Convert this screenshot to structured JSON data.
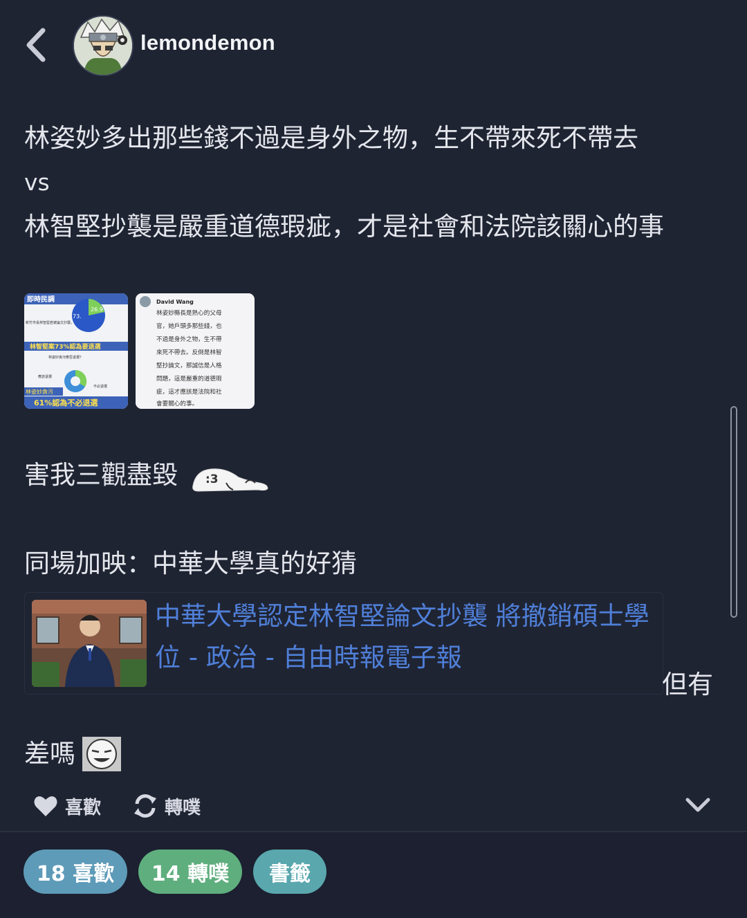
{
  "header": {
    "username": "lemondemon"
  },
  "post": {
    "line1": "林姿妙多出那些錢不過是身外之物，生不帶來死不帶去",
    "line2": "vs",
    "line3": "林智堅抄襲是嚴重道德瑕疵，才是社會和法院該關心的事",
    "section2": "害我三觀盡毀",
    "section3": "同場加映：中華大學真的好猜",
    "link_title": "中華大學認定林智堅論文抄襲 將撤銷碩士學位 - 政治 - 自由時報電子報",
    "after_link": "但有",
    "section4": "差嗎"
  },
  "image1": {
    "brand": "即時民調",
    "pct_big": "73.",
    "pct_small": "26.9",
    "q1": "新竹市長林智堅若被論文抄襲，",
    "headline1": "林智堅案73%認為要退選",
    "q2": "林姿妙貪污應否退選？",
    "name_tag": "林姿妙貪污",
    "headline2": "61%認為不必退選",
    "opt_a": "應該退選",
    "opt_b": "不必退選"
  },
  "image2": {
    "author": "David Wang",
    "lines": [
      "林姿妙縣長是熱心的父母",
      "官，她戶頭多那些錢，也",
      "不過是身外之物，生不帶",
      "來死不帶去。反倒是林智",
      "堅抄論文，那誠信是人格",
      "問題，這是嚴重的道德瑕",
      "疵，這才應該是法院和社",
      "會要關心的事。"
    ]
  },
  "actions": {
    "like": "喜歡",
    "replurk": "轉噗"
  },
  "footer": {
    "likes": "18 喜歡",
    "replurks": "14 轉噗",
    "bookmark": "書籤"
  },
  "colors": {
    "background": "#1f2433",
    "link": "#4f7fd8",
    "likes_pill": "#5e9bb8",
    "replurks_pill": "#5fae7e",
    "bookmark_pill": "#5aa7ae"
  }
}
